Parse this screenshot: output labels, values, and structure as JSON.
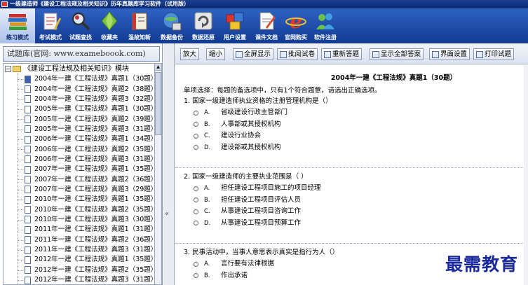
{
  "window": {
    "title": "一级建造师《建设工程法规及相关知识》历年真题库学习软件（试用版）"
  },
  "toolbar": {
    "items": [
      {
        "label": "练习模式",
        "icon": "books-icon",
        "active": true
      },
      {
        "label": "考试模式",
        "icon": "pencil-paper-icon"
      },
      {
        "label": "试题查找",
        "icon": "magnifier-icon"
      },
      {
        "label": "收藏夹",
        "icon": "diamond-icon"
      },
      {
        "label": "温故知新",
        "icon": "notebook-icon"
      },
      {
        "label": "数据备份",
        "icon": "globe-disk-icon"
      },
      {
        "label": "数据还原",
        "icon": "refresh-icon"
      },
      {
        "label": "用户设置",
        "icon": "settings-blocks-icon"
      },
      {
        "label": "课件文档",
        "icon": "document-icon"
      },
      {
        "label": "官网购买",
        "icon": "ie-browser-icon"
      },
      {
        "label": "软件注册",
        "icon": "users-icon"
      }
    ]
  },
  "left": {
    "header": "试题库(官网: www.exameboook.com)",
    "root": "《建设工程法规及相关知识》模块",
    "items": [
      "2004年一建《工程法规》真题1（30题）",
      "2004年一建《工程法规》真题2（38题）",
      "2004年一建《工程法规》真题3（32题）",
      "2005年一建《工程法规》真题1（30题）",
      "2005年一建《工程法规》真题2（39题）",
      "2005年一建《工程法规》真题3（31题）",
      "2006年一建《工程法规》真题1（34题）",
      "2006年一建《工程法规》真题2（35题）",
      "2006年一建《工程法规》真题3（31题）",
      "2007年一建《工程法规》真题1（35题）",
      "2007年一建《工程法规》真题2（36题）",
      "2007年一建《工程法规》真题3（29题）",
      "2010年一建《工程法规》真题1（35题）",
      "2010年一建《工程法规》真题2（35题）",
      "2010年一建《工程法规》真题3（30题）",
      "2011年一建《工程法规》真题1（31题）",
      "2011年一建《工程法规》真题2（36题）",
      "2011年一建《工程法规》真题3（31题）",
      "2012年一建《工程法规》真题1（35题）",
      "2012年一建《工程法规》真题2（35题）",
      "2012年一建《工程法规》真题3（31题）"
    ]
  },
  "rtoolbar": {
    "zoom_in": "放大",
    "zoom_out": "缩小",
    "fullscreen": "全屏显示",
    "grade": "批阅试卷",
    "redo": "重新答题",
    "show_answers": "显示全部答案",
    "ui_settings": "界面设置",
    "print": "打印试题"
  },
  "question_area": {
    "title": "2004年一建《工程法规》真题1（30题）",
    "instruction": "单项选择：每题的备选项中，只有1个符合题意，请选出正确选项。",
    "questions": [
      {
        "stem": "1. 国家一级建造师执业资格的注册管理机构是（）",
        "options": [
          {
            "letter": "A.",
            "text": "省级建设行政主管部门"
          },
          {
            "letter": "B.",
            "text": "人事部或其授权机构"
          },
          {
            "letter": "C.",
            "text": "建设行业协会"
          },
          {
            "letter": "D.",
            "text": "建设部或其授权机构"
          }
        ]
      },
      {
        "stem": "2. 国家一级建造师的主要执业范围是（ ）",
        "options": [
          {
            "letter": "A.",
            "text": "担任建设工程项目施工的项目经理"
          },
          {
            "letter": "B.",
            "text": "担任建设工程项目评估人员"
          },
          {
            "letter": "C.",
            "text": "从事建设工程项目咨询工作"
          },
          {
            "letter": "D.",
            "text": "从事建设工程项目预算工作"
          }
        ]
      },
      {
        "stem": "3. 民事活动中，当事人意思表示真实是指行为人（）",
        "options": [
          {
            "letter": "A.",
            "text": "言行要有法律根据"
          },
          {
            "letter": "B.",
            "text": "作出承诺"
          }
        ]
      }
    ]
  },
  "watermark": "最需教育",
  "colors": {
    "toolbar_blue": "#1f4fb0",
    "watermark": "#1a2a9c"
  }
}
